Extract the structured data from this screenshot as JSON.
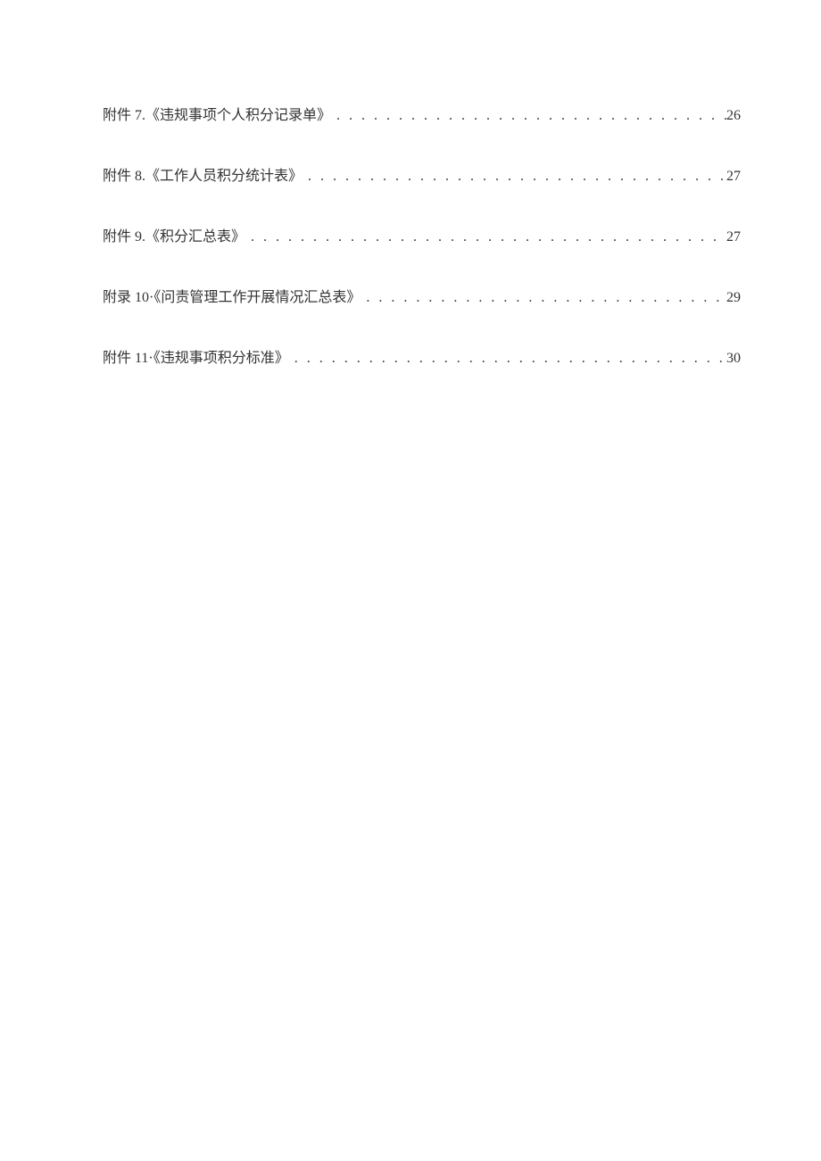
{
  "toc": {
    "entries": [
      {
        "label": "附件 7.《违规事项个人积分记录单》",
        "page": "26"
      },
      {
        "label": "附件 8.《工作人员积分统计表》",
        "page": "27"
      },
      {
        "label": "附件 9.《积分汇总表》",
        "page": "27"
      },
      {
        "label": "附录 10·《问责管理工作开展情况汇总表》",
        "page": "29"
      },
      {
        "label": "附件 11·《违规事项积分标准》",
        "page": "30"
      }
    ]
  }
}
